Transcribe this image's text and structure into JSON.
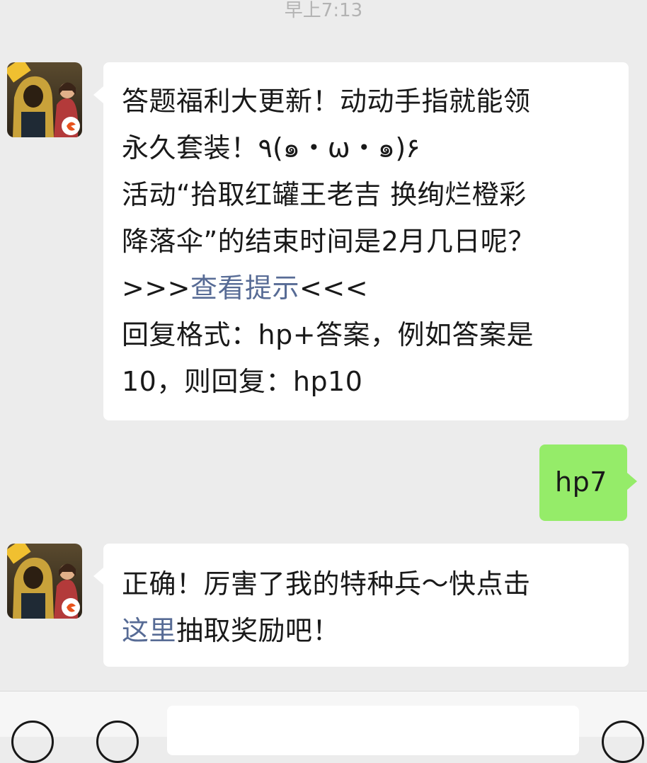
{
  "chat": {
    "timestamp": "早上7:13",
    "messages": [
      {
        "side": "incoming",
        "lines_before_link": "答题福利大更新！动动手指就能领\n永久套装！٩(๑・ω・๑)۶\n活动“拾取红罐王老吉 换绚烂橙彩\n降落伞”的结束时间是2月几日呢？\n>>>",
        "link": "查看提示",
        "lines_after_link": "<<<\n回复格式：hp+答案，例如答案是\n10，则回复：hp10"
      },
      {
        "side": "outgoing",
        "text": "hp7"
      },
      {
        "side": "incoming",
        "text_before_link": "正确！厉害了我的特种兵～快点击\n",
        "link": "这里",
        "text_after_link": "抽取奖励吧！"
      }
    ],
    "avatar_badge": "光子"
  },
  "input_bar": {
    "placeholder": ""
  },
  "icons": {
    "voice_toggle": "voice-icon",
    "back": "back-icon",
    "emoji": "emoji-icon"
  },
  "colors": {
    "background": "#ececec",
    "incoming_bubble": "#ffffff",
    "outgoing_bubble": "#95ec69",
    "link": "#576b95",
    "timestamp": "#b3b3b3"
  }
}
